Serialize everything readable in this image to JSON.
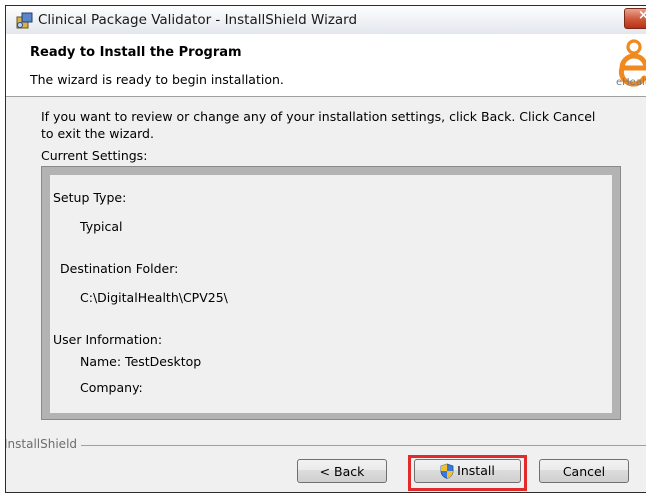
{
  "window": {
    "title": "Clinical Package Validator - InstallShield Wizard",
    "close_symbol": "×"
  },
  "header": {
    "title": "Ready to Install the Program",
    "subtitle": "The wizard is ready to begin installation.",
    "logo_text": "eHealth"
  },
  "body": {
    "info_text": "If you want to review or change any of your installation settings, click Back. Click Cancel to exit the wizard.",
    "current_settings_label": "Current Settings:"
  },
  "settings": {
    "setup_type_label": "Setup Type:",
    "setup_type_value": "Typical",
    "destination_label": "Destination Folder:",
    "destination_value": "C:\\DigitalHealth\\CPV25\\",
    "user_info_label": "User Information:",
    "name_line": "Name: TestDesktop",
    "company_line": "Company:"
  },
  "footer": {
    "brand": "InstallShield",
    "back_label": "< Back",
    "install_label": "Install",
    "cancel_label": "Cancel"
  },
  "colors": {
    "accent_highlight": "#e32a2a",
    "close_button": "#cf5c3f"
  },
  "icons": [
    "installer-app-icon",
    "close-icon",
    "ehealth-logo",
    "uac-shield-icon"
  ]
}
